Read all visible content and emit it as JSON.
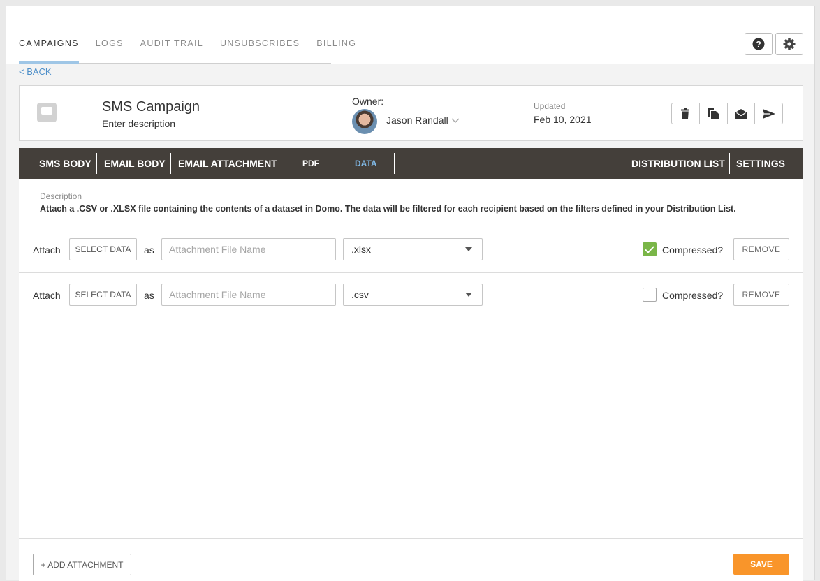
{
  "topnav": {
    "tabs": [
      {
        "label": "CAMPAIGNS",
        "active": true
      },
      {
        "label": "LOGS",
        "active": false
      },
      {
        "label": "AUDIT TRAIL",
        "active": false
      },
      {
        "label": "UNSUBSCRIBES",
        "active": false
      },
      {
        "label": "BILLING",
        "active": false
      }
    ],
    "help_icon": "question-circle-icon",
    "settings_icon": "gear-icon"
  },
  "back_link": "< BACK",
  "campaign": {
    "title": "SMS Campaign",
    "description": "Enter description",
    "owner_label": "Owner:",
    "owner_name": "Jason Randall",
    "updated_label": "Updated",
    "updated_value": "Feb 10, 2021",
    "actions": [
      "trash-icon",
      "copy-icon",
      "envelope-open-icon",
      "send-icon"
    ]
  },
  "content_tabs": {
    "left": [
      {
        "label": "SMS BODY",
        "active": false
      },
      {
        "label": "EMAIL BODY",
        "active": false
      },
      {
        "label": "EMAIL ATTACHMENT",
        "active": false
      },
      {
        "label": "PDF",
        "active": false
      },
      {
        "label": "DATA",
        "active": true
      }
    ],
    "right": [
      {
        "label": "DISTRIBUTION LIST",
        "active": false
      },
      {
        "label": "SETTINGS",
        "active": false
      }
    ]
  },
  "data_tab": {
    "description_label": "Description",
    "description_text": "Attach a .CSV or .XLSX file containing the contents of a dataset in Domo. The data will be filtered for each recipient based on the filters defined in your Distribution List.",
    "attachments": [
      {
        "attach_label": "Attach",
        "select_label": "SELECT DATA",
        "as_label": "as",
        "file_name_placeholder": "Attachment File Name",
        "file_name_value": "",
        "format": ".xlsx",
        "compressed": true,
        "compressed_label": "Compressed?",
        "remove_label": "REMOVE"
      },
      {
        "attach_label": "Attach",
        "select_label": "SELECT DATA",
        "as_label": "as",
        "file_name_placeholder": "Attachment File Name",
        "file_name_value": "",
        "format": ".csv",
        "compressed": false,
        "compressed_label": "Compressed?",
        "remove_label": "REMOVE"
      }
    ],
    "add_attachment_label": "+ ADD ATTACHMENT",
    "save_label": "SAVE"
  },
  "colors": {
    "accent_blue": "#7fb6e2",
    "tab_bar": "#443f3a",
    "save_orange": "#f9952a",
    "checkbox_green": "#7ab648"
  }
}
